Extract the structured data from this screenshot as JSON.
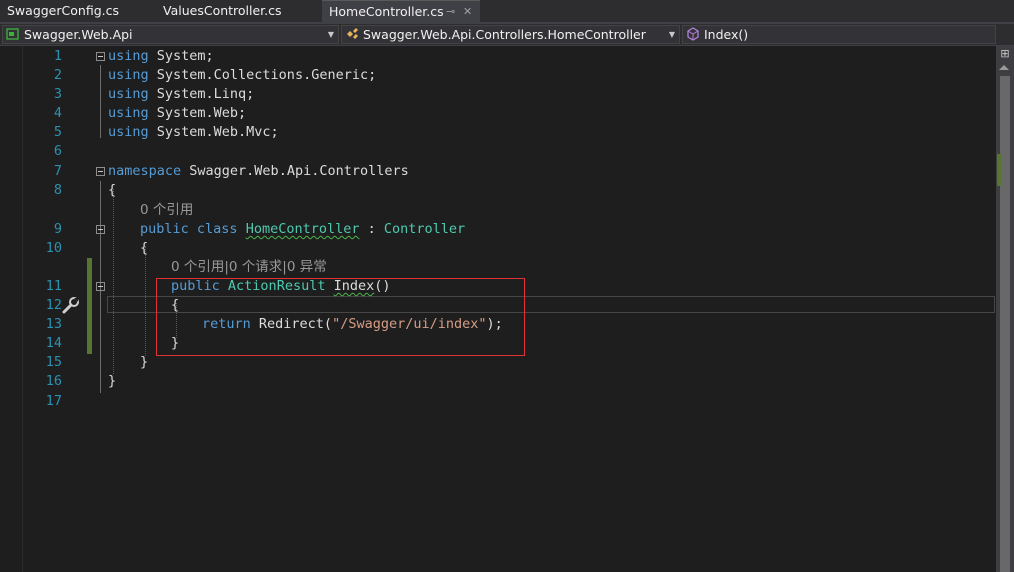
{
  "tabs": [
    {
      "label": "SwaggerConfig.cs",
      "active": false
    },
    {
      "label": "ValuesController.cs",
      "active": false
    },
    {
      "label": "HomeController.cs",
      "active": true,
      "pin": "⊸",
      "close": "✕"
    }
  ],
  "nav": {
    "project": "Swagger.Web.Api",
    "type": "Swagger.Web.Api.Controllers.HomeController",
    "member": "Index()"
  },
  "editor": {
    "line_numbers": [
      "1",
      "2",
      "3",
      "4",
      "5",
      "6",
      "7",
      "8",
      "9",
      "10",
      "11",
      "12",
      "13",
      "14",
      "15",
      "16",
      "17"
    ],
    "codelens": {
      "class_refs": "0 个引用",
      "method_refs": "0 个引用|0 个请求|0 异常"
    },
    "code": {
      "l1_kw": "using",
      "l1_rest": " System;",
      "l2_kw": "using",
      "l2_rest": " System.Collections.Generic;",
      "l3_kw": "using",
      "l3_rest": " System.Linq;",
      "l4_kw": "using",
      "l4_rest": " System.Web;",
      "l5_kw": "using",
      "l5_rest": " System.Web.Mvc;",
      "l7_kw": "namespace",
      "l7_rest": " Swagger.Web.Api.Controllers",
      "l8": "{",
      "l9_kw": "public class",
      "l9_name": "HomeController",
      "l9_sep": " : ",
      "l9_base": "Controller",
      "l10": "{",
      "l11_kw": "public",
      "l11_type": "ActionResult",
      "l11_name": "Index",
      "l11_paren": "()",
      "l12": "{",
      "l13_kw": "return",
      "l13_call": " Redirect(",
      "l13_str": "\"/Swagger/ui/index\"",
      "l13_end": ");",
      "l14": "}",
      "l15": "}",
      "l16": "}"
    }
  },
  "colors": {
    "background": "#1e1e1e",
    "keyword": "#569cd6",
    "type": "#4ec9b0",
    "string": "#d69d85",
    "line_number": "#2b91af",
    "highlight_box": "#dd3333",
    "change_marker": "#577430"
  },
  "icons": [
    "csharp-project-icon",
    "class-icon",
    "method-icon",
    "wrench-icon",
    "split-icon"
  ]
}
